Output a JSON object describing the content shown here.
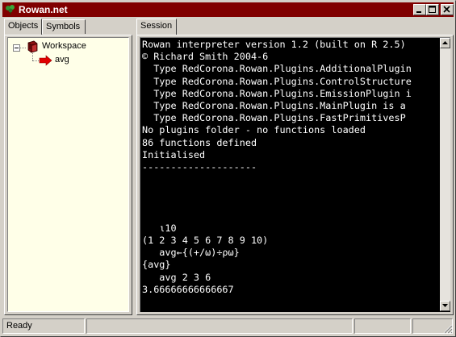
{
  "window": {
    "title": "Rowan.net",
    "controls": [
      "minimize",
      "maximize",
      "close"
    ]
  },
  "left_panel": {
    "tabs": [
      {
        "label": "Objects",
        "active": true
      },
      {
        "label": "Symbols",
        "active": false
      }
    ],
    "tree": {
      "root": {
        "label": "Workspace",
        "icon": "workspace-book-icon",
        "expanded": true,
        "expander": "−"
      },
      "children": [
        {
          "label": "avg",
          "icon": "red-arrow-icon"
        }
      ]
    }
  },
  "right_panel": {
    "tabs": [
      {
        "label": "Session",
        "active": true
      }
    ],
    "console_lines": [
      "Rowan interpreter version 1.2 (built on R 2.5)",
      "© Richard Smith 2004-6",
      "  Type RedCorona.Rowan.Plugins.AdditionalPlugin",
      "  Type RedCorona.Rowan.Plugins.ControlStructure",
      "  Type RedCorona.Rowan.Plugins.EmissionPlugin i",
      "  Type RedCorona.Rowan.Plugins.MainPlugin is a",
      "  Type RedCorona.Rowan.Plugins.FastPrimitivesP",
      "No plugins folder - no functions loaded",
      "86 functions defined",
      "Initialised",
      "--------------------",
      "",
      "",
      "",
      "",
      "   ⍳10",
      "(1 2 3 4 5 6 7 8 9 10)",
      "   avg←{(+/ω)÷ρω}",
      "{avg}",
      "   avg 2 3 6",
      "3.66666666666667"
    ]
  },
  "statusbar": {
    "text": "Ready",
    "cells": [
      "",
      "",
      ""
    ]
  },
  "colors": {
    "titlebar": "#800000",
    "tree_background": "#ffffe8",
    "console_background": "#000000",
    "console_text": "#ffffff",
    "face": "#d4d0c8"
  }
}
